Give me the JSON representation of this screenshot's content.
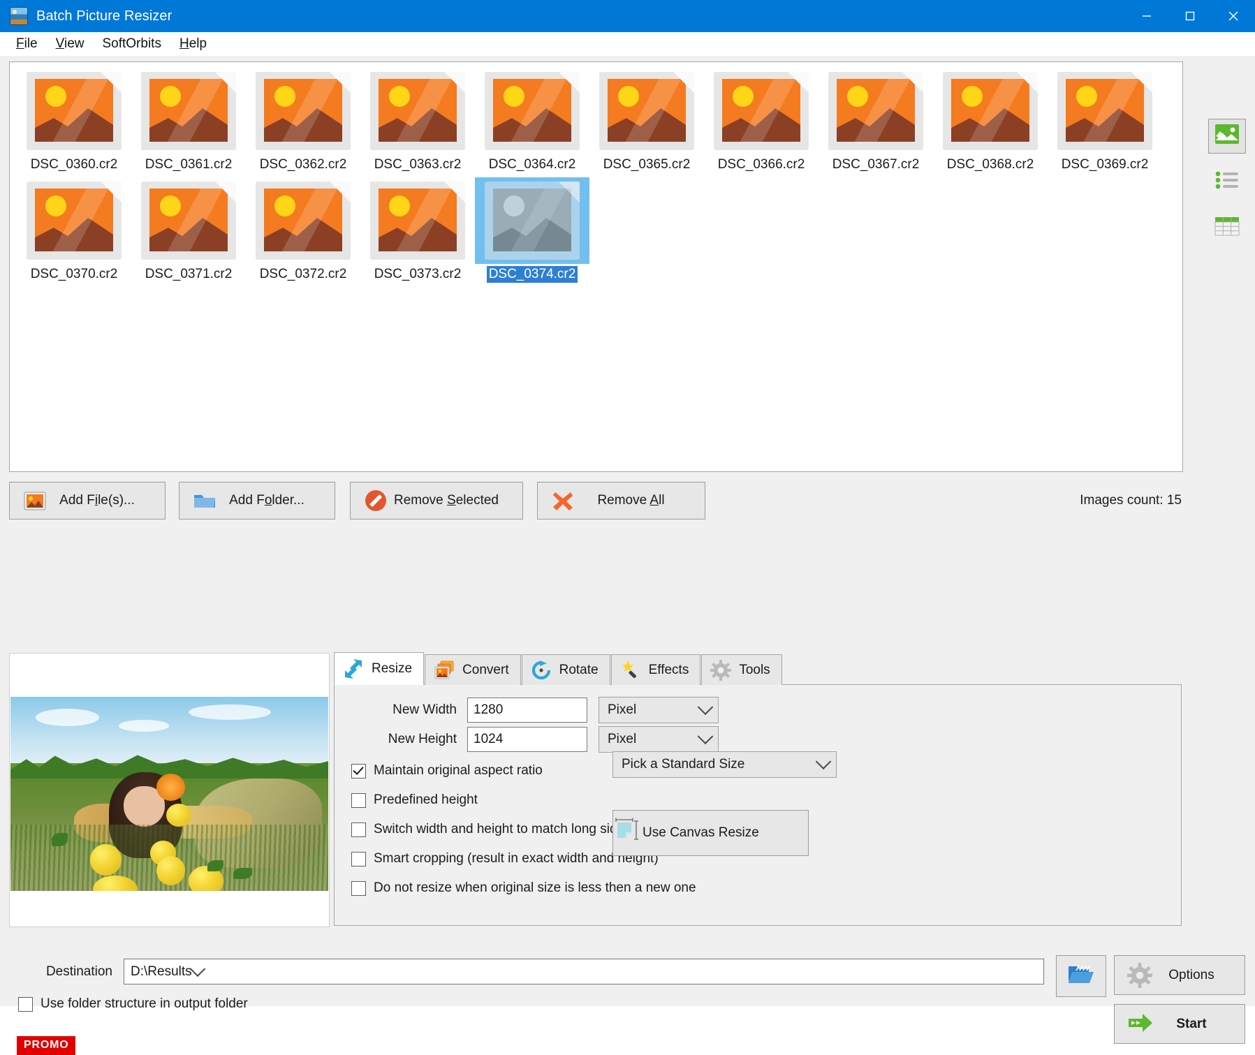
{
  "window": {
    "title": "Batch Picture Resizer",
    "app_icon": "app-photo-icon",
    "minimize": "–",
    "maximize": "□",
    "close": "✕"
  },
  "menu": {
    "items": [
      {
        "label": "File",
        "accel": "F"
      },
      {
        "label": "View",
        "accel": "V"
      },
      {
        "label": "SoftOrbits",
        "accel": ""
      },
      {
        "label": "Help",
        "accel": "H"
      }
    ]
  },
  "file_list": {
    "files": [
      {
        "name": "DSC_0360.cr2",
        "selected": false
      },
      {
        "name": "DSC_0361.cr2",
        "selected": false
      },
      {
        "name": "DSC_0362.cr2",
        "selected": false
      },
      {
        "name": "DSC_0363.cr2",
        "selected": false
      },
      {
        "name": "DSC_0364.cr2",
        "selected": false
      },
      {
        "name": "DSC_0365.cr2",
        "selected": false
      },
      {
        "name": "DSC_0366.cr2",
        "selected": false
      },
      {
        "name": "DSC_0367.cr2",
        "selected": false
      },
      {
        "name": "DSC_0368.cr2",
        "selected": false
      },
      {
        "name": "DSC_0369.cr2",
        "selected": false
      },
      {
        "name": "DSC_0370.cr2",
        "selected": false
      },
      {
        "name": "DSC_0371.cr2",
        "selected": false
      },
      {
        "name": "DSC_0372.cr2",
        "selected": false
      },
      {
        "name": "DSC_0373.cr2",
        "selected": false
      },
      {
        "name": "DSC_0374.cr2",
        "selected": true
      }
    ]
  },
  "view_modes": [
    {
      "name": "thumbnail-view",
      "icon": "picture-icon",
      "active": true
    },
    {
      "name": "list-view",
      "icon": "list-icon",
      "active": false
    },
    {
      "name": "details-view",
      "icon": "table-icon",
      "active": false
    }
  ],
  "actions": {
    "add_files": "Add File(s)...",
    "add_folder": "Add Folder...",
    "remove_selected": "Remove Selected",
    "remove_all": "Remove All",
    "images_count": "Images count: 15"
  },
  "tabs": [
    {
      "label": "Resize",
      "icon": "resize-arrows-icon",
      "active": true
    },
    {
      "label": "Convert",
      "icon": "convert-images-icon",
      "active": false
    },
    {
      "label": "Rotate",
      "icon": "rotate-arrow-icon",
      "active": false
    },
    {
      "label": "Effects",
      "icon": "magic-wand-icon",
      "active": false
    },
    {
      "label": "Tools",
      "icon": "gear-icon",
      "active": false
    }
  ],
  "resize_tab": {
    "new_width_label": "New Width",
    "new_width_value": "1280",
    "new_width_unit": "Pixel",
    "new_height_label": "New Height",
    "new_height_value": "1024",
    "new_height_unit": "Pixel",
    "standard_size": "Pick a Standard Size",
    "canvas_resize": "Use Canvas Resize",
    "checkboxes": [
      {
        "label": "Maintain original aspect ratio",
        "checked": true
      },
      {
        "label": "Predefined height",
        "checked": false
      },
      {
        "label": "Switch width and height to match long sides",
        "checked": false
      },
      {
        "label": "Smart cropping (result in exact width and height)",
        "checked": false
      },
      {
        "label": "Do not resize when original size is less then a new one",
        "checked": false
      }
    ]
  },
  "bottom": {
    "destination_label": "Destination",
    "destination_value": "D:\\Results",
    "browse_icon": "open-folder-icon",
    "use_folder_structure": "Use folder structure in output folder",
    "use_folder_structure_checked": false,
    "promo": "PROMO",
    "options": "Options",
    "start": "Start"
  },
  "colors": {
    "titlebar": "#0078d7",
    "selection": "#2d7fd3",
    "promo_red": "#e00000",
    "start_green": "#5cb82e",
    "accent_orange": "#f47b20"
  }
}
